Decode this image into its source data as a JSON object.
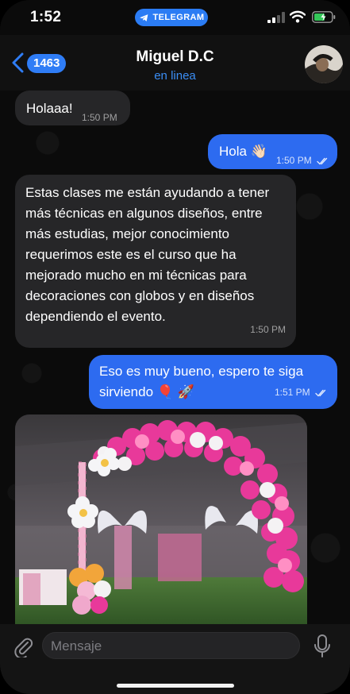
{
  "status_bar": {
    "time": "1:52",
    "app_pill": "TELEGRAM"
  },
  "header": {
    "back_count": "1463",
    "contact_name": "Miguel D.C",
    "contact_status": "en linea"
  },
  "messages": [
    {
      "direction": "incoming",
      "text": "Holaaa!",
      "time": "1:50 PM"
    },
    {
      "direction": "outgoing",
      "text": "Hola 👋🏻",
      "time": "1:50 PM",
      "read": true
    },
    {
      "direction": "incoming",
      "text": "Estas clases me están ayudando a tener más técnicas en algunos diseños, entre más estudias, mejor conocimiento requerimos este es el curso que ha mejorado mucho en mi técnicas para decoraciones con globos y en diseños dependiendo el evento.",
      "time": "1:50 PM"
    },
    {
      "direction": "outgoing",
      "text": "Eso es muy bueno, espero te siga sirviendo 🎈 🚀",
      "time": "1:51 PM",
      "read": true
    },
    {
      "direction": "incoming",
      "type": "photo"
    }
  ],
  "input": {
    "placeholder": "Mensaje"
  },
  "colors": {
    "accent": "#2f7df6",
    "outgoing_bubble": "#2d6bf0",
    "incoming_bubble": "#262628",
    "status_online": "#3b8ef5"
  },
  "icons": [
    "telegram-plane-icon",
    "signal-icon",
    "wifi-icon",
    "battery-icon",
    "back-chevron-icon",
    "attach-paperclip-icon",
    "microphone-icon",
    "read-checks-icon"
  ]
}
